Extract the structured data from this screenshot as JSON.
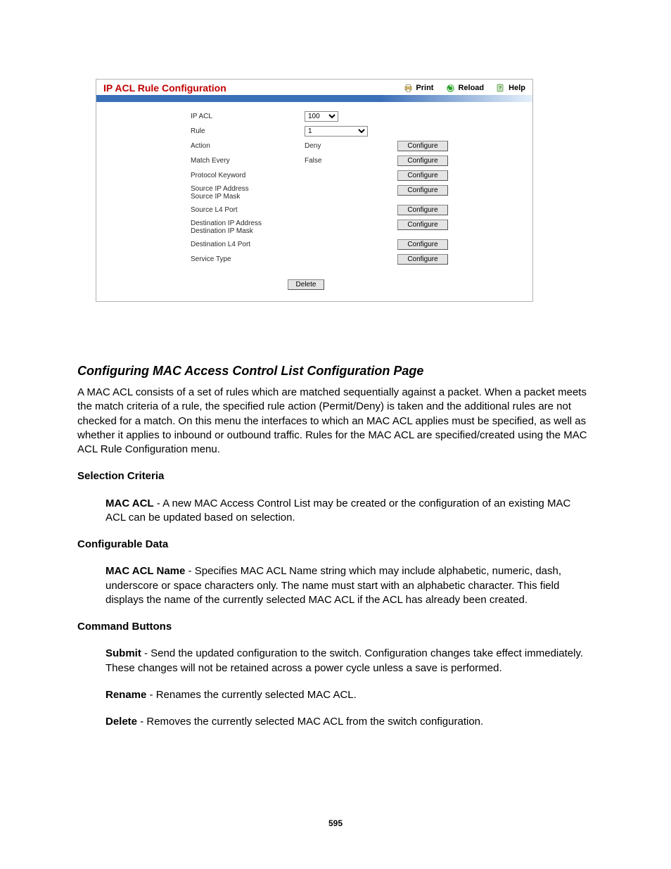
{
  "panel": {
    "title": "IP ACL Rule Configuration",
    "header_actions": {
      "print": "Print",
      "reload": "Reload",
      "help": "Help"
    },
    "rows": {
      "ip_acl": {
        "label": "IP ACL",
        "value": "100"
      },
      "rule": {
        "label": "Rule",
        "value": "1"
      },
      "action": {
        "label": "Action",
        "value": "Deny",
        "btn": "Configure"
      },
      "match": {
        "label": "Match Every",
        "value": "False",
        "btn": "Configure"
      },
      "protocol": {
        "label": "Protocol Keyword",
        "btn": "Configure"
      },
      "src_ip": {
        "label1": "Source IP Address",
        "label2": "Source IP Mask",
        "btn": "Configure"
      },
      "src_port": {
        "label": "Source L4 Port",
        "btn": "Configure"
      },
      "dst_ip": {
        "label1": "Destination IP Address",
        "label2": "Destination IP Mask",
        "btn": "Configure"
      },
      "dst_port": {
        "label": "Destination L4 Port",
        "btn": "Configure"
      },
      "svc": {
        "label": "Service Type",
        "btn": "Configure"
      }
    },
    "delete_btn": "Delete"
  },
  "doc": {
    "section_heading": "Configuring MAC Access Control List Configuration Page",
    "intro": "A MAC ACL consists of a set of rules which are matched sequentially against a packet. When a packet meets the match criteria of a rule, the specified rule action (Permit/Deny) is taken and the additional rules are not checked for a match. On this menu the interfaces to which an MAC ACL applies must be specified, as well as whether it applies to inbound or outbound traffic. Rules for the MAC ACL are specified/created using the MAC ACL Rule Configuration menu.",
    "selcrit_head": "Selection Criteria",
    "mac_acl": {
      "term": "MAC ACL",
      "text": " - A new MAC Access Control List may be created or the configuration of an existing MAC ACL can be updated based on selection."
    },
    "confdata_head": "Configurable Data",
    "mac_acl_name": {
      "term": "MAC ACL Name",
      "text": " - Specifies MAC ACL Name string which may include alphabetic, numeric, dash, underscore or space characters only. The name must start with an alphabetic character. This field displays the name of the currently selected MAC ACL if the ACL has already been created."
    },
    "cmdbtn_head": "Command Buttons",
    "submit": {
      "term": "Submit",
      "text": " - Send the updated configuration to the switch. Configuration changes take effect immediately. These changes will not be retained across a power cycle unless a save is performed."
    },
    "rename": {
      "term": "Rename",
      "text": " - Renames the currently selected MAC ACL."
    },
    "delete": {
      "term": "Delete",
      "text": " - Removes the currently selected MAC ACL from the switch configuration."
    }
  },
  "page_number": "595"
}
